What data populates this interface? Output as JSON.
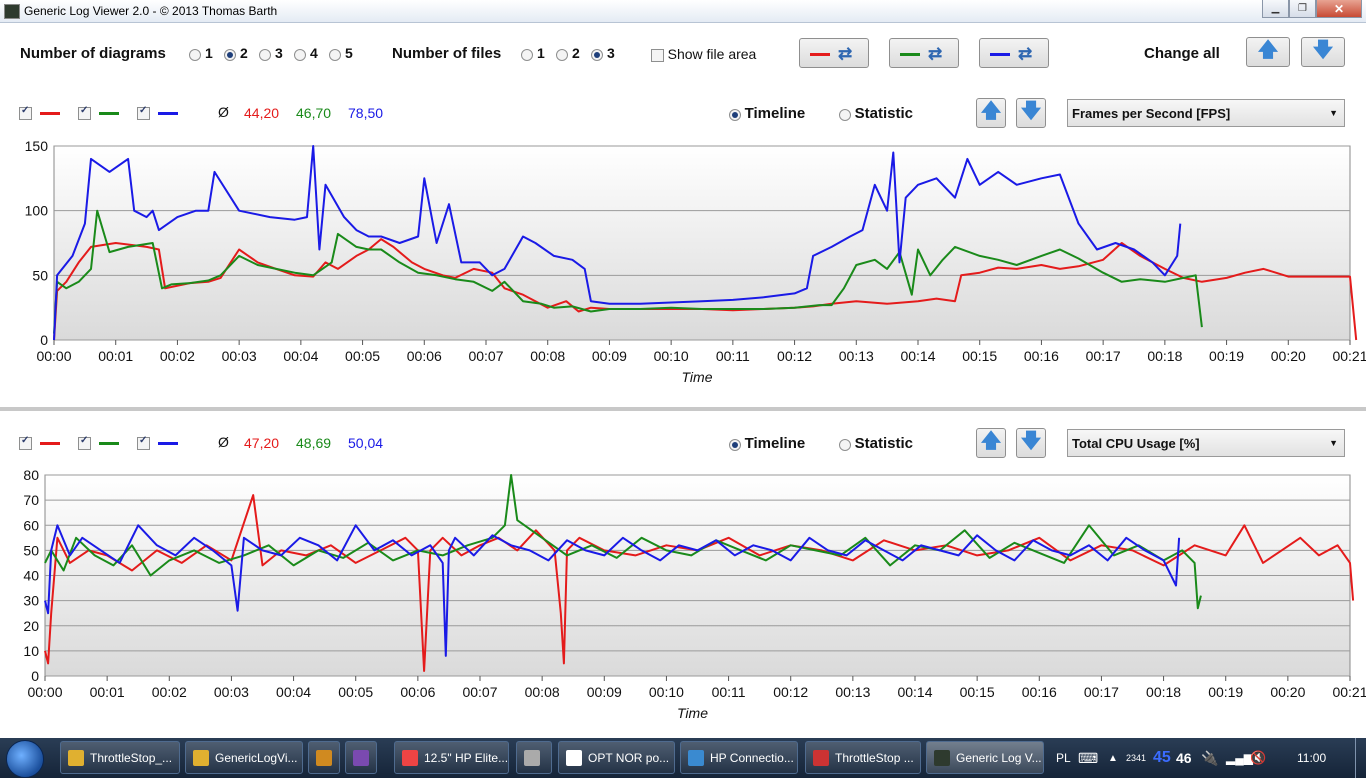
{
  "window": {
    "title": "Generic Log Viewer 2.0 - © 2013 Thomas Barth"
  },
  "toolbar": {
    "diagrams_label": "Number of diagrams",
    "diagram_options": [
      "1",
      "2",
      "3",
      "4",
      "5"
    ],
    "diagram_selected": "2",
    "files_label": "Number of files",
    "file_options": [
      "1",
      "2",
      "3"
    ],
    "file_selected": "3",
    "show_file_area_label": "Show file area",
    "change_all_label": "Change all"
  },
  "colors": {
    "series1": "#e41b1b",
    "series2": "#1a8a1a",
    "series3": "#1a1ae6"
  },
  "panels": [
    {
      "avg_symbol": "Ø",
      "averages": [
        "44,20",
        "46,70",
        "78,50"
      ],
      "timeline_label": "Timeline",
      "statistic_label": "Statistic",
      "view_selected": "Timeline",
      "metric": "Frames per Second [FPS]"
    },
    {
      "avg_symbol": "Ø",
      "averages": [
        "47,20",
        "48,69",
        "50,04"
      ],
      "timeline_label": "Timeline",
      "statistic_label": "Statistic",
      "view_selected": "Timeline",
      "metric": "Total CPU Usage [%]"
    }
  ],
  "chart_data": [
    {
      "type": "line",
      "title": "",
      "xlabel": "Time",
      "ylabel": "",
      "ylim": [
        0,
        150
      ],
      "yticks": [
        0,
        50,
        100,
        150
      ],
      "xlim": [
        0,
        21
      ],
      "xtick_labels": [
        "00:00",
        "00:01",
        "00:02",
        "00:03",
        "00:04",
        "00:05",
        "00:06",
        "00:07",
        "00:08",
        "00:09",
        "00:10",
        "00:11",
        "00:12",
        "00:13",
        "00:14",
        "00:15",
        "00:16",
        "00:17",
        "00:18",
        "00:19",
        "00:20",
        "00:21"
      ],
      "grid": true,
      "series": [
        {
          "color": "red",
          "x": [
            0,
            0.05,
            0.2,
            0.4,
            0.6,
            1.0,
            1.5,
            1.7,
            1.8,
            2.2,
            2.5,
            2.7,
            3.0,
            3.3,
            3.6,
            3.9,
            4.2,
            4.4,
            4.6,
            4.9,
            5.1,
            5.3,
            5.5,
            5.8,
            6.0,
            6.3,
            6.5,
            6.8,
            7.1,
            7.3,
            7.6,
            7.8,
            8.0,
            8.3,
            8.5,
            8.7,
            9.0,
            9.5,
            10.0,
            10.5,
            11.0,
            11.5,
            12.0,
            12.3,
            12.6,
            13.0,
            13.5,
            14.0,
            14.3,
            14.6,
            14.7,
            15.0,
            15.3,
            15.6,
            16.0,
            16.3,
            16.6,
            17.0,
            17.3,
            17.6,
            18.0,
            18.3,
            18.6,
            19.0,
            19.3,
            19.6,
            19.8,
            20.0,
            20.5,
            21.0,
            21.1
          ],
          "y": [
            0,
            38,
            45,
            60,
            72,
            75,
            72,
            70,
            40,
            44,
            45,
            48,
            70,
            60,
            55,
            50,
            49,
            60,
            55,
            65,
            70,
            78,
            72,
            60,
            55,
            50,
            48,
            55,
            52,
            40,
            35,
            30,
            25,
            30,
            22,
            25,
            24,
            24,
            24,
            24,
            23,
            24,
            25,
            26,
            28,
            30,
            28,
            30,
            32,
            30,
            50,
            52,
            56,
            55,
            58,
            55,
            57,
            62,
            75,
            65,
            55,
            48,
            45,
            48,
            52,
            55,
            52,
            49,
            49,
            49,
            0
          ]
        },
        {
          "color": "green",
          "x": [
            0,
            0.05,
            0.2,
            0.4,
            0.6,
            0.7,
            0.9,
            1.2,
            1.6,
            1.75,
            1.9,
            2.2,
            2.5,
            2.7,
            3.0,
            3.3,
            3.6,
            3.9,
            4.2,
            4.5,
            4.6,
            4.9,
            5.1,
            5.3,
            5.6,
            5.9,
            6.2,
            6.5,
            6.8,
            7.1,
            7.3,
            7.6,
            7.9,
            8.1,
            8.4,
            8.7,
            9.0,
            9.5,
            10.0,
            10.5,
            11.0,
            11.5,
            12.0,
            12.4,
            12.6,
            12.8,
            13.0,
            13.3,
            13.5,
            13.7,
            13.9,
            14.0,
            14.2,
            14.4,
            14.6,
            15.0,
            15.3,
            15.6,
            16.0,
            16.3,
            16.6,
            17.0,
            17.3,
            17.6,
            18.0,
            18.3,
            18.5,
            18.6
          ],
          "y": [
            5,
            45,
            40,
            45,
            55,
            100,
            68,
            72,
            75,
            40,
            43,
            44,
            46,
            50,
            65,
            58,
            55,
            52,
            50,
            60,
            82,
            72,
            70,
            70,
            60,
            52,
            50,
            47,
            45,
            38,
            45,
            30,
            28,
            25,
            26,
            22,
            24,
            24,
            25,
            24,
            24,
            24,
            25,
            27,
            27,
            40,
            58,
            62,
            55,
            68,
            35,
            70,
            50,
            62,
            72,
            65,
            62,
            58,
            65,
            70,
            63,
            52,
            45,
            47,
            45,
            48,
            50,
            10
          ]
        },
        {
          "color": "blue",
          "x": [
            0,
            0.05,
            0.3,
            0.5,
            0.6,
            0.9,
            1.2,
            1.3,
            1.5,
            1.6,
            1.7,
            2.0,
            2.3,
            2.5,
            2.6,
            3.0,
            3.5,
            3.9,
            4.1,
            4.2,
            4.3,
            4.4,
            4.7,
            4.9,
            5.1,
            5.3,
            5.6,
            5.9,
            6.0,
            6.2,
            6.4,
            6.6,
            6.9,
            7.1,
            7.3,
            7.6,
            7.8,
            8.1,
            8.4,
            8.6,
            8.7,
            9.0,
            9.5,
            10.0,
            10.5,
            11.0,
            11.5,
            12.0,
            12.2,
            12.3,
            12.6,
            12.9,
            13.1,
            13.3,
            13.5,
            13.6,
            13.7,
            13.8,
            14.0,
            14.3,
            14.6,
            14.8,
            15.0,
            15.3,
            15.6,
            16.0,
            16.3,
            16.6,
            16.9,
            17.2,
            17.5,
            17.8,
            18.0,
            18.2,
            18.25
          ],
          "y": [
            0,
            50,
            65,
            90,
            140,
            130,
            140,
            100,
            95,
            100,
            85,
            95,
            100,
            100,
            130,
            100,
            95,
            93,
            95,
            150,
            70,
            120,
            95,
            85,
            80,
            80,
            75,
            80,
            125,
            75,
            105,
            60,
            60,
            50,
            55,
            80,
            75,
            65,
            62,
            55,
            30,
            28,
            28,
            29,
            30,
            31,
            33,
            36,
            40,
            65,
            72,
            80,
            85,
            120,
            100,
            145,
            60,
            110,
            120,
            125,
            110,
            140,
            120,
            130,
            120,
            125,
            128,
            90,
            70,
            75,
            70,
            60,
            50,
            65,
            90
          ]
        }
      ]
    },
    {
      "type": "line",
      "title": "",
      "xlabel": "Time",
      "ylabel": "",
      "ylim": [
        0,
        80
      ],
      "yticks": [
        0,
        10,
        20,
        30,
        40,
        50,
        60,
        70,
        80
      ],
      "xlim": [
        0,
        21
      ],
      "xtick_labels": [
        "00:00",
        "00:01",
        "00:02",
        "00:03",
        "00:04",
        "00:05",
        "00:06",
        "00:07",
        "00:08",
        "00:09",
        "00:10",
        "00:11",
        "00:12",
        "00:13",
        "00:14",
        "00:15",
        "00:16",
        "00:17",
        "00:18",
        "00:19",
        "00:20",
        "00:21"
      ],
      "grid": true,
      "series": [
        {
          "color": "red",
          "x": [
            0,
            0.05,
            0.1,
            0.2,
            0.4,
            0.7,
            1.0,
            1.4,
            1.8,
            2.2,
            2.6,
            3.0,
            3.35,
            3.5,
            3.8,
            4.2,
            4.6,
            5.0,
            5.4,
            5.8,
            6.0,
            6.1,
            6.2,
            6.4,
            6.7,
            7.0,
            7.3,
            7.6,
            7.9,
            8.2,
            8.3,
            8.35,
            8.4,
            8.6,
            9.0,
            9.5,
            10.0,
            10.5,
            11.0,
            11.5,
            12.0,
            12.5,
            13.0,
            13.5,
            14.0,
            14.5,
            15.0,
            15.5,
            16.0,
            16.5,
            17.0,
            17.5,
            18.0,
            18.5,
            19.0,
            19.3,
            19.6,
            19.9,
            20.2,
            20.5,
            20.8,
            21.0,
            21.05
          ],
          "y": [
            10,
            5,
            25,
            55,
            45,
            50,
            48,
            42,
            50,
            45,
            52,
            46,
            72,
            44,
            50,
            48,
            52,
            45,
            50,
            55,
            50,
            2,
            50,
            55,
            48,
            52,
            55,
            50,
            58,
            50,
            25,
            5,
            50,
            55,
            50,
            48,
            52,
            50,
            55,
            48,
            52,
            50,
            46,
            54,
            50,
            52,
            48,
            50,
            55,
            46,
            52,
            50,
            44,
            52,
            48,
            60,
            45,
            50,
            55,
            48,
            52,
            45,
            30
          ]
        },
        {
          "color": "green",
          "x": [
            0,
            0.1,
            0.3,
            0.5,
            0.8,
            1.1,
            1.4,
            1.7,
            2.0,
            2.4,
            2.8,
            3.2,
            3.6,
            4.0,
            4.4,
            4.8,
            5.2,
            5.6,
            6.0,
            6.4,
            6.8,
            7.2,
            7.4,
            7.5,
            7.6,
            8.0,
            8.4,
            8.8,
            9.2,
            9.6,
            10.0,
            10.4,
            10.8,
            11.2,
            11.6,
            12.0,
            12.4,
            12.8,
            13.2,
            13.6,
            14.0,
            14.4,
            14.8,
            15.2,
            15.6,
            16.0,
            16.4,
            16.8,
            17.2,
            17.6,
            18.0,
            18.3,
            18.5,
            18.55,
            18.6
          ],
          "y": [
            45,
            50,
            42,
            55,
            48,
            44,
            52,
            40,
            46,
            50,
            45,
            48,
            52,
            44,
            50,
            47,
            53,
            46,
            50,
            48,
            52,
            55,
            60,
            80,
            62,
            55,
            48,
            52,
            47,
            55,
            50,
            48,
            54,
            50,
            46,
            52,
            50,
            48,
            55,
            44,
            52,
            50,
            58,
            47,
            53,
            49,
            45,
            60,
            48,
            52,
            46,
            50,
            45,
            27,
            32
          ]
        },
        {
          "color": "blue",
          "x": [
            0,
            0.05,
            0.1,
            0.2,
            0.4,
            0.6,
            0.9,
            1.2,
            1.5,
            1.8,
            2.1,
            2.4,
            2.7,
            3.0,
            3.1,
            3.2,
            3.5,
            3.8,
            4.1,
            4.4,
            4.7,
            5.0,
            5.3,
            5.6,
            5.9,
            6.2,
            6.4,
            6.45,
            6.5,
            6.6,
            6.9,
            7.2,
            7.5,
            7.8,
            8.1,
            8.4,
            8.7,
            9.0,
            9.3,
            9.6,
            9.9,
            10.2,
            10.5,
            10.8,
            11.1,
            11.4,
            11.7,
            12.0,
            12.3,
            12.6,
            12.9,
            13.2,
            13.5,
            13.8,
            14.1,
            14.4,
            14.7,
            15.0,
            15.3,
            15.6,
            15.9,
            16.2,
            16.5,
            16.8,
            17.1,
            17.4,
            17.7,
            18.0,
            18.2,
            18.25
          ],
          "y": [
            30,
            25,
            50,
            60,
            48,
            55,
            50,
            45,
            60,
            52,
            48,
            55,
            50,
            44,
            26,
            55,
            50,
            48,
            55,
            52,
            46,
            60,
            50,
            54,
            48,
            52,
            45,
            8,
            50,
            55,
            48,
            56,
            52,
            50,
            46,
            54,
            50,
            48,
            55,
            50,
            46,
            52,
            50,
            54,
            48,
            52,
            50,
            46,
            55,
            50,
            48,
            54,
            50,
            46,
            52,
            50,
            48,
            56,
            50,
            46,
            54,
            50,
            48,
            52,
            46,
            55,
            50,
            46,
            36,
            55
          ]
        }
      ]
    }
  ],
  "taskbar": {
    "tasks": [
      "ThrottleStop_...",
      "GenericLogVi...",
      "",
      "",
      "12.5\" HP Elite...",
      "",
      "OPT NOR po...",
      "HP Connectio...",
      "ThrottleStop ...",
      "Generic Log V..."
    ],
    "lang": "PL",
    "tray_num_small": "2341",
    "tray_num_blue": "45",
    "tray_num_white": "46",
    "clock": "11:00"
  }
}
